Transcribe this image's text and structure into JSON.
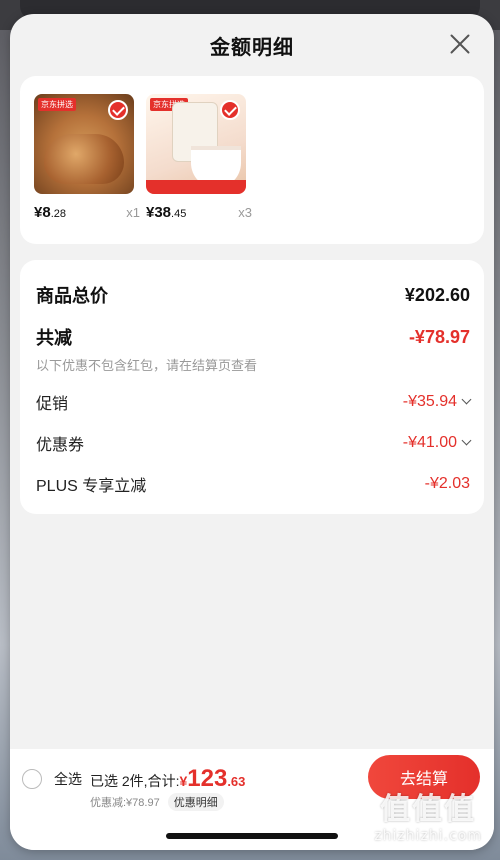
{
  "sheet": {
    "title": "金额明细",
    "close_icon": "close-icon"
  },
  "products": [
    {
      "price_int": "¥8",
      "price_dec": ".28",
      "qty": "x1",
      "tag": "京东拼选"
    },
    {
      "price_int": "¥38",
      "price_dec": ".45",
      "qty": "x3",
      "tag": "京东拼选"
    }
  ],
  "summary": {
    "total_label": "商品总价",
    "total_value": "¥202.60",
    "reduce_label": "共减",
    "reduce_value": "-¥78.97",
    "note": "以下优惠不包含红包，请在结算页查看",
    "promo_label": "促销",
    "promo_value": "-¥35.94",
    "coupon_label": "优惠券",
    "coupon_value": "-¥41.00",
    "plus_label": "PLUS 专享立减",
    "plus_value": "-¥2.03"
  },
  "bottom": {
    "select_all": "全选",
    "selected_prefix": "已选 2件,合计:",
    "total_sym": "¥",
    "total_int": "123",
    "total_dec": ".63",
    "discount_text": "优惠减:¥78.97",
    "detail_chip": "优惠明细",
    "checkout": "去结算"
  },
  "watermark": {
    "logo": "值值值",
    "url": "zhizhizhi.com"
  },
  "colors": {
    "accent": "#e4302b",
    "sheet_bg": "#f2f2f2"
  }
}
